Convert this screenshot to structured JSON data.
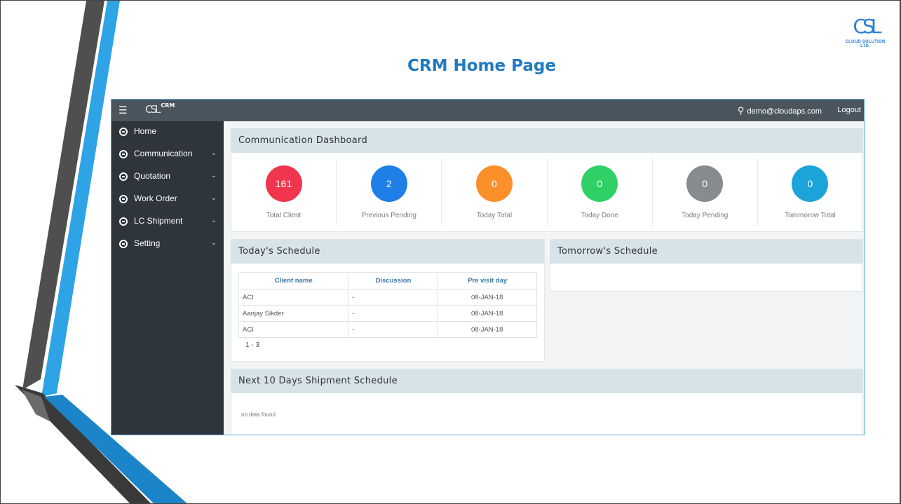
{
  "slide": {
    "title": "CRM Home Page",
    "logo_mark": "CSL",
    "logo_tagline": "CLOUD SOLUTION LTD."
  },
  "topbar": {
    "menu_icon": "hamburger-icon",
    "brand_mark": "CSL",
    "brand_name": "CRM",
    "user_email": "demo@cloudaps.com",
    "logout": "Logout"
  },
  "sidebar": {
    "items": [
      {
        "label": "Home",
        "expandable": false
      },
      {
        "label": "Communication",
        "expandable": true
      },
      {
        "label": "Quotation",
        "expandable": true
      },
      {
        "label": "Work Order",
        "expandable": true
      },
      {
        "label": "LC Shipment",
        "expandable": true
      },
      {
        "label": "Setting",
        "expandable": true
      }
    ]
  },
  "dashboard": {
    "title": "Communication Dashboard",
    "stats": [
      {
        "value": "161",
        "label": "Total Client",
        "color": "#f0364f"
      },
      {
        "value": "2",
        "label": "Previous Pending",
        "color": "#1e7fe6"
      },
      {
        "value": "0",
        "label": "Today Total",
        "color": "#fb8f2a"
      },
      {
        "value": "0",
        "label": "Today Done",
        "color": "#2fd166"
      },
      {
        "value": "0",
        "label": "Today Pending",
        "color": "#868b8e"
      },
      {
        "value": "0",
        "label": "Tommorow Total",
        "color": "#1ca3d8"
      }
    ]
  },
  "today": {
    "title": "Today's Schedule",
    "columns": [
      "Client name",
      "Discussion",
      "Pre visit day"
    ],
    "rows": [
      [
        "ACI",
        "-",
        "08-JAN-18"
      ],
      [
        "Aanjay Sikder",
        "-",
        "08-JAN-18"
      ],
      [
        "ACI",
        "-",
        "08-JAN-18"
      ]
    ],
    "pager": "1 - 3"
  },
  "tomorrow": {
    "title": "Tomorrow's Schedule"
  },
  "shipment": {
    "title": "Next 10 Days Shipment Schedule",
    "empty": "no data found"
  }
}
